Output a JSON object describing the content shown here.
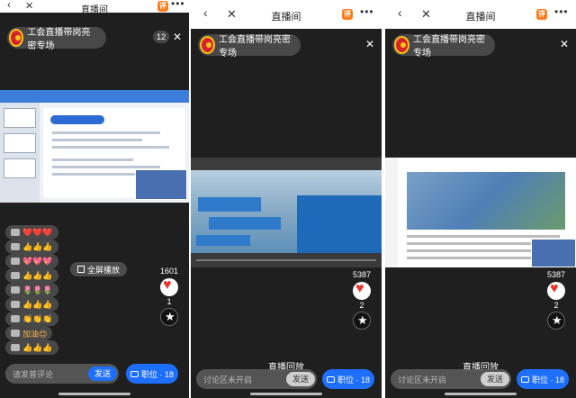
{
  "screens": [
    {
      "nav": {
        "back": "‹",
        "close": "✕",
        "title": "直播间",
        "mini_badge": "评",
        "more": "•••"
      },
      "badge_text": "工会直播带岗亮密专场",
      "viewer_count": "12",
      "close_x": "✕",
      "comments": [
        {
          "text": "❤️❤️❤️"
        },
        {
          "text": "👍👍👍"
        },
        {
          "text": "💖💖💖"
        },
        {
          "text": "👍👍👍"
        },
        {
          "text": "🌷🌷🌷"
        },
        {
          "text": "👍👍👍"
        },
        {
          "text": "👏👏👏"
        },
        {
          "text": "加油😊"
        },
        {
          "text": "👍👍👍"
        }
      ],
      "fullscreen_label": "全屏播放",
      "like_count": "1601",
      "star_count": "1",
      "input_placeholder": "请发普评论",
      "send_label": "发送",
      "job_label": "职位 · 18"
    },
    {
      "nav": {
        "back": "‹",
        "close": "✕",
        "title": "直播间",
        "mini_badge": "评",
        "more": "•••"
      },
      "badge_text": "工会直播带岗亮密专场",
      "close_x": "✕",
      "like_count": "5387",
      "star_count": "2",
      "replay_label": "直播回放",
      "input_placeholder": "讨论区未开启",
      "send_label": "发送",
      "job_label": "职位 · 18"
    },
    {
      "nav": {
        "back": "‹",
        "close": "✕",
        "title": "直播间",
        "mini_badge": "评",
        "more": "•••"
      },
      "badge_text": "工会直播带岗亮密专场",
      "close_x": "✕",
      "like_count": "5387",
      "star_count": "2",
      "replay_label": "直播回放",
      "input_placeholder": "讨论区未开启",
      "send_label": "发送",
      "job_label": "职位 · 18"
    }
  ],
  "colors": {
    "accent_blue": "#1e6fff",
    "heart_red": "#e8362d",
    "logo_red": "#d5232a"
  }
}
